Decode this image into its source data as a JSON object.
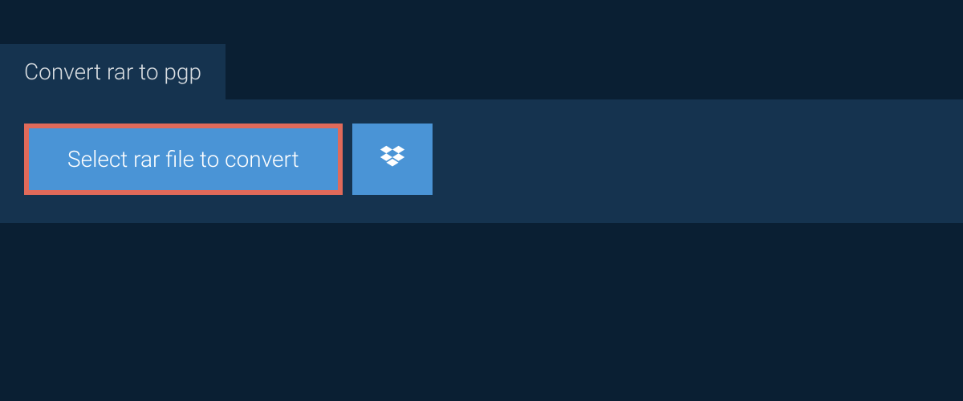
{
  "tab": {
    "title": "Convert rar to pgp"
  },
  "actions": {
    "select_file_label": "Select rar file to convert"
  }
}
